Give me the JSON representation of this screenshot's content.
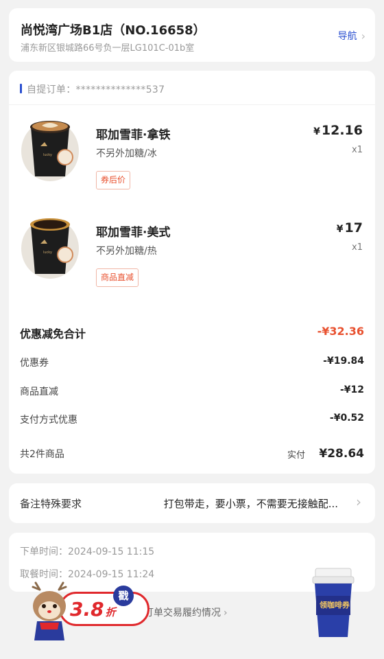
{
  "store": {
    "name": "尚悦湾广场B1店（NO.16658）",
    "address": "浦东新区银城路66号负一层LG101C-01b室",
    "nav_label": "导航",
    "nav_icon": "chevron-right-icon"
  },
  "order": {
    "label": "自提订单：**************537",
    "items": [
      {
        "name": "耶加雪菲·拿铁",
        "spec": "不另外加糖/冰",
        "tag": "券后价",
        "currency": "¥",
        "price": "12.16",
        "qty": "x1"
      },
      {
        "name": "耶加雪菲·美式",
        "spec": "不另外加糖/热",
        "tag": "商品直减",
        "currency": "¥",
        "price": "17",
        "qty": "x1"
      }
    ],
    "summary": {
      "total_discount_label": "优惠减免合计",
      "total_discount_value": "-¥32.36",
      "rows": [
        {
          "label": "优惠券",
          "value": "-¥19.84"
        },
        {
          "label": "商品直减",
          "value": "-¥12"
        },
        {
          "label": "支付方式优惠",
          "value": "-¥0.52"
        }
      ],
      "count_label": "共2件商品",
      "paid_label": "实付",
      "paid_value": "¥28.64"
    }
  },
  "remark": {
    "label": "备注特殊要求",
    "value": "打包带走，要小票，不需要无接触配..."
  },
  "times": {
    "order_time": "下单时间：2024-09-15 11:15",
    "pickup_time": "取餐时间：2024-09-15 11:24"
  },
  "footer": {
    "link": "订单交易履约情况",
    "promo_text": "3.8",
    "promo_unit": "折",
    "promo_stamp": "戳",
    "cup_label": "领咖啡券"
  },
  "colors": {
    "accent_blue": "#2a4fd0",
    "discount_red": "#e8502e",
    "background": "#f2f2f2"
  }
}
